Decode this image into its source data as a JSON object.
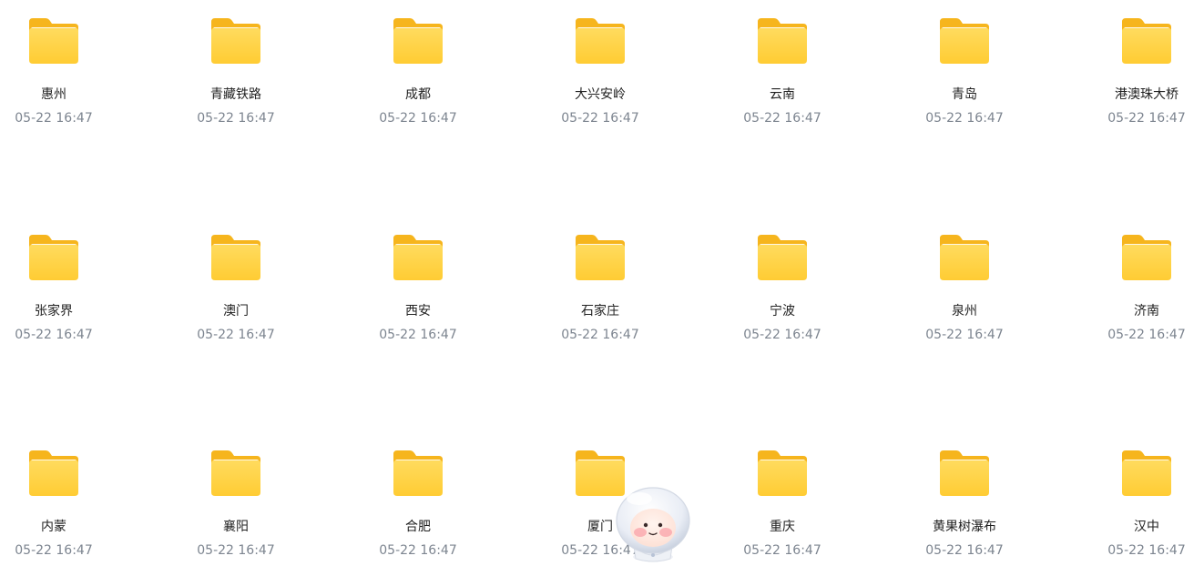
{
  "folders": [
    {
      "name": "惠州",
      "date": "05-22 16:47"
    },
    {
      "name": "青藏铁路",
      "date": "05-22 16:47"
    },
    {
      "name": "成都",
      "date": "05-22 16:47"
    },
    {
      "name": "大兴安岭",
      "date": "05-22 16:47"
    },
    {
      "name": "云南",
      "date": "05-22 16:47"
    },
    {
      "name": "青岛",
      "date": "05-22 16:47"
    },
    {
      "name": "港澳珠大桥",
      "date": "05-22 16:47"
    },
    {
      "name": "张家界",
      "date": "05-22 16:47"
    },
    {
      "name": "澳门",
      "date": "05-22 16:47"
    },
    {
      "name": "西安",
      "date": "05-22 16:47"
    },
    {
      "name": "石家庄",
      "date": "05-22 16:47"
    },
    {
      "name": "宁波",
      "date": "05-22 16:47"
    },
    {
      "name": "泉州",
      "date": "05-22 16:47"
    },
    {
      "name": "济南",
      "date": "05-22 16:47"
    },
    {
      "name": "内蒙",
      "date": "05-22 16:47"
    },
    {
      "name": "襄阳",
      "date": "05-22 16:47"
    },
    {
      "name": "合肥",
      "date": "05-22 16:47"
    },
    {
      "name": "厦门",
      "date": "05-22 16:47"
    },
    {
      "name": "重庆",
      "date": "05-22 16:47"
    },
    {
      "name": "黄果树瀑布",
      "date": "05-22 16:47"
    },
    {
      "name": "汉中",
      "date": "05-22 16:47"
    }
  ],
  "icons": {
    "folder": "folder-icon",
    "mascot": "astronaut-mascot"
  },
  "colors": {
    "folder_back": "#f7b81f",
    "folder_front": "#ffd64d",
    "name_text": "#222222",
    "date_text": "#7d8590"
  }
}
